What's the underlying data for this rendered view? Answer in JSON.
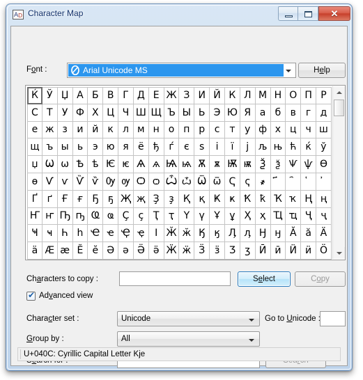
{
  "window": {
    "title": "Character Map",
    "icon": "character-map-icon",
    "buttons": {
      "minimize": "minimize-icon",
      "maximize": "maximize-icon",
      "close": "✕"
    }
  },
  "font_row": {
    "label_pre": "F",
    "label_acc": "o",
    "label_post": "nt :",
    "selected_font": "Arial Unicode MS",
    "font_icon": "truetype-icon",
    "help_pre": "H",
    "help_acc": "e",
    "help_post": "lp"
  },
  "grid": {
    "columns": 20,
    "focused_index": 0,
    "rows": [
      [
        "Ќ",
        "Ў",
        "Џ",
        "А",
        "Б",
        "В",
        "Г",
        "Д",
        "Е",
        "Ж",
        "З",
        "И",
        "Й",
        "К",
        "Л",
        "М",
        "Н",
        "О",
        "П",
        "Р"
      ],
      [
        "С",
        "Т",
        "У",
        "Ф",
        "Х",
        "Ц",
        "Ч",
        "Ш",
        "Щ",
        "Ъ",
        "Ы",
        "Ь",
        "Э",
        "Ю",
        "Я",
        "а",
        "б",
        "в",
        "г",
        "д"
      ],
      [
        "е",
        "ж",
        "з",
        "и",
        "й",
        "к",
        "л",
        "м",
        "н",
        "о",
        "п",
        "р",
        "с",
        "т",
        "у",
        "ф",
        "х",
        "ц",
        "ч",
        "ш"
      ],
      [
        "щ",
        "ъ",
        "ы",
        "ь",
        "э",
        "ю",
        "я",
        "ё",
        "ђ",
        "ѓ",
        "є",
        "ѕ",
        "і",
        "ї",
        "ј",
        "љ",
        "њ",
        "ћ",
        "ќ",
        "ў"
      ],
      [
        "џ",
        "Ѡ",
        "ѡ",
        "Ѣ",
        "ѣ",
        "Ѥ",
        "ѥ",
        "Ѧ",
        "ѧ",
        "Ѩ",
        "ѩ",
        "Ѫ",
        "ѫ",
        "Ѭ",
        "ѭ",
        "Ѯ",
        "ѯ",
        "Ѱ",
        "ѱ",
        "Ѳ"
      ],
      [
        "ѳ",
        "Ѵ",
        "ѵ",
        "Ѷ",
        "ѷ",
        "Ѹ",
        "ѹ",
        "Ѻ",
        "ѻ",
        "Ѽ",
        "ѽ",
        "Ѿ",
        "ѿ",
        "Ҁ",
        "ҁ",
        "҂",
        "҃",
        "҄",
        "҅",
        "҆"
      ],
      [
        "Ґ",
        "ґ",
        "Ғ",
        "ғ",
        "Ҕ",
        "ҕ",
        "Җ",
        "җ",
        "Ҙ",
        "ҙ",
        "Қ",
        "қ",
        "Ҝ",
        "ҝ",
        "Ҟ",
        "ҟ",
        "Ҡ",
        "ҡ",
        "Ң",
        "ң"
      ],
      [
        "Ҥ",
        "ҥ",
        "Ҧ",
        "ҧ",
        "Ҩ",
        "ҩ",
        "Ҫ",
        "ҫ",
        "Ҭ",
        "ҭ",
        "Ү",
        "ү",
        "Ұ",
        "ұ",
        "Ҳ",
        "ҳ",
        "Ҵ",
        "ҵ",
        "Ҷ",
        "ҷ"
      ],
      [
        "Ҹ",
        "ҹ",
        "Һ",
        "һ",
        "Ҽ",
        "ҽ",
        "Ҿ",
        "ҿ",
        "Ӏ",
        "Ӂ",
        "ӂ",
        "Ӄ",
        "ӄ",
        "Ӆ",
        "ӆ",
        "Ӈ",
        "ӈ",
        "Ӑ",
        "ӑ",
        "Ӓ"
      ],
      [
        "ӓ",
        "Ӕ",
        "ӕ",
        "Ӗ",
        "ӗ",
        "Ә",
        "ә",
        "Ӛ",
        "ӛ",
        "Ӝ",
        "ӝ",
        "Ӟ",
        "ӟ",
        "Ӡ",
        "ӡ",
        "Ӣ",
        "ӣ",
        "Ӥ",
        "ӥ",
        "Ӧ"
      ]
    ]
  },
  "copy_row": {
    "label_pre": "Ch",
    "label_acc": "a",
    "label_post": "racters to copy :",
    "value": "",
    "select_pre": "S",
    "select_acc": "e",
    "select_post": "lect",
    "copy_pre": "C",
    "copy_acc": "o",
    "copy_post": "py"
  },
  "advanced": {
    "checked": true,
    "label_pre": "Ad",
    "label_acc": "v",
    "label_post": "anced view"
  },
  "charset_row": {
    "label_pre": "Chara",
    "label_acc": "c",
    "label_post": "ter set :",
    "value": "Unicode",
    "goto_pre": "Go to ",
    "goto_acc": "U",
    "goto_post": "nicode :",
    "goto_value": ""
  },
  "groupby_row": {
    "label_pre": "",
    "label_acc": "G",
    "label_post": "roup by :",
    "value": "All"
  },
  "search_row": {
    "label_pre": "S",
    "label_acc": "e",
    "label_post": "arch for :",
    "value": "",
    "button_pre": "Sea",
    "button_acc": "r",
    "button_post": "ch"
  },
  "status": {
    "text": "U+040C: Cyrillic Capital Letter Kje"
  }
}
